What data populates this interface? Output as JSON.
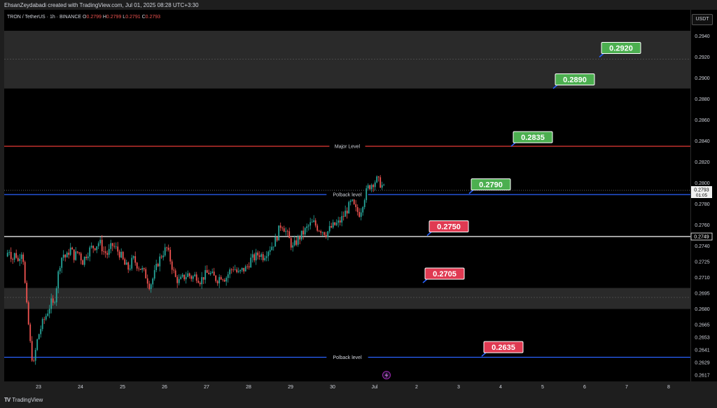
{
  "header": {
    "text": "EhsanZeydabadi created with TradingView.com, Jul 01, 2025 08:28 UTC+3:30"
  },
  "legend": {
    "symbol": "TRON / TetherUS · 1h · BINANCE",
    "o_label": "O",
    "o_value": "0.2799",
    "h_label": "H",
    "h_value": "0.2799",
    "l_label": "L",
    "l_value": "0.2791",
    "c_label": "C",
    "c_value": "0.2793"
  },
  "currency_label": "USDT",
  "brand": {
    "logo": "TV",
    "name": "TradingView"
  },
  "chart_data": {
    "type": "candlestick",
    "y_axis": {
      "min": 0.2611,
      "max": 0.2965,
      "tick_labels": [
        "0.2940",
        "0.2920",
        "0.2900",
        "0.2880",
        "0.2860",
        "0.2840",
        "0.2820",
        "0.2800",
        "0.2780",
        "0.2760",
        "0.2740",
        "0.2725",
        "0.2710",
        "0.2695",
        "0.2680",
        "0.2665",
        "0.2653",
        "0.2641",
        "0.2629",
        "0.2617"
      ]
    },
    "x_axis": {
      "tick_labels": [
        "23",
        "24",
        "25",
        "26",
        "27",
        "28",
        "29",
        "30",
        "Jul",
        "2",
        "3",
        "4",
        "5",
        "6",
        "7",
        "8"
      ],
      "tick_positions_days": [
        0,
        1,
        2,
        3,
        4,
        5,
        6,
        7,
        8,
        9,
        10,
        11,
        12,
        13,
        14,
        15
      ]
    },
    "current_price": {
      "value": 0.2793,
      "label": "0.2793",
      "countdown": "01:05",
      "color": "#f0f0f0"
    },
    "marked_price": {
      "value": 0.2749,
      "label": "0.2749"
    },
    "zones": [
      {
        "from": 0.289,
        "to": 0.2945,
        "color": "#2a2a2a",
        "midline": 0.2918
      },
      {
        "from": 0.268,
        "to": 0.27,
        "color": "#2a2a2a",
        "midline": 0.2691
      }
    ],
    "horizontal_lines": [
      {
        "value": 0.2835,
        "label": "Major Level",
        "color": "#e53935"
      },
      {
        "value": 0.2789,
        "label": "Polback level",
        "color": "#2962ff"
      },
      {
        "value": 0.2749,
        "label": "",
        "color": "#ffffff"
      },
      {
        "value": 0.2634,
        "label": "Polback level",
        "color": "#2962ff"
      }
    ],
    "targets": [
      {
        "value": "0.2920",
        "price": 0.292,
        "day": 13.4,
        "color": "#4caf50"
      },
      {
        "value": "0.2890",
        "price": 0.289,
        "day": 12.3,
        "color": "#4caf50"
      },
      {
        "value": "0.2835",
        "price": 0.2835,
        "day": 11.3,
        "color": "#4caf50"
      },
      {
        "value": "0.2790",
        "price": 0.279,
        "day": 10.3,
        "color": "#4caf50"
      },
      {
        "value": "0.2750",
        "price": 0.275,
        "day": 9.3,
        "color": "#e03a52"
      },
      {
        "value": "0.2705",
        "price": 0.2705,
        "day": 9.2,
        "color": "#e03a52"
      },
      {
        "value": "0.2635",
        "price": 0.2635,
        "day": 10.6,
        "color": "#e03a52"
      }
    ],
    "candles_path": [
      [
        -0.78,
        0.273
      ],
      [
        -0.7,
        0.2737
      ],
      [
        -0.62,
        0.2727
      ],
      [
        -0.55,
        0.2734
      ],
      [
        -0.48,
        0.2724
      ],
      [
        -0.42,
        0.2738
      ],
      [
        -0.36,
        0.2727
      ],
      [
        -0.3,
        0.269
      ],
      [
        -0.25,
        0.267
      ],
      [
        -0.2,
        0.2648
      ],
      [
        -0.16,
        0.2636
      ],
      [
        -0.12,
        0.2625
      ],
      [
        -0.08,
        0.2638
      ],
      [
        -0.04,
        0.2648
      ],
      [
        0.0,
        0.2655
      ],
      [
        0.08,
        0.2665
      ],
      [
        0.16,
        0.2672
      ],
      [
        0.24,
        0.268
      ],
      [
        0.3,
        0.2686
      ],
      [
        0.36,
        0.2683
      ],
      [
        0.42,
        0.27
      ],
      [
        0.5,
        0.2722
      ],
      [
        0.58,
        0.2733
      ],
      [
        0.66,
        0.2728
      ],
      [
        0.75,
        0.2738
      ],
      [
        0.85,
        0.273
      ],
      [
        0.95,
        0.2735
      ],
      [
        1.05,
        0.2725
      ],
      [
        1.15,
        0.2733
      ],
      [
        1.25,
        0.2738
      ],
      [
        1.35,
        0.274
      ],
      [
        1.45,
        0.2744
      ],
      [
        1.55,
        0.2735
      ],
      [
        1.65,
        0.2732
      ],
      [
        1.75,
        0.2741
      ],
      [
        1.85,
        0.2737
      ],
      [
        1.95,
        0.2732
      ],
      [
        2.05,
        0.2722
      ],
      [
        2.15,
        0.2718
      ],
      [
        2.25,
        0.2728
      ],
      [
        2.35,
        0.2722
      ],
      [
        2.45,
        0.2718
      ],
      [
        2.55,
        0.2712
      ],
      [
        2.65,
        0.2702
      ],
      [
        2.75,
        0.2712
      ],
      [
        2.85,
        0.2725
      ],
      [
        2.95,
        0.2733
      ],
      [
        3.05,
        0.2738
      ],
      [
        3.15,
        0.2725
      ],
      [
        3.25,
        0.271
      ],
      [
        3.35,
        0.2706
      ],
      [
        3.45,
        0.271
      ],
      [
        3.55,
        0.2713
      ],
      [
        3.65,
        0.271
      ],
      [
        3.75,
        0.2712
      ],
      [
        3.85,
        0.2707
      ],
      [
        3.95,
        0.2712
      ],
      [
        4.05,
        0.2715
      ],
      [
        4.15,
        0.2711
      ],
      [
        4.25,
        0.2708
      ],
      [
        4.35,
        0.2712
      ],
      [
        4.45,
        0.2709
      ],
      [
        4.55,
        0.2716
      ],
      [
        4.65,
        0.272
      ],
      [
        4.75,
        0.2713
      ],
      [
        4.85,
        0.2717
      ],
      [
        4.95,
        0.2719
      ],
      [
        5.05,
        0.2727
      ],
      [
        5.15,
        0.2729
      ],
      [
        5.25,
        0.2733
      ],
      [
        5.35,
        0.273
      ],
      [
        5.45,
        0.2736
      ],
      [
        5.55,
        0.274
      ],
      [
        5.65,
        0.2746
      ],
      [
        5.72,
        0.2755
      ],
      [
        5.78,
        0.2762
      ],
      [
        5.86,
        0.2756
      ],
      [
        5.95,
        0.2748
      ],
      [
        6.05,
        0.2738
      ],
      [
        6.15,
        0.2745
      ],
      [
        6.25,
        0.275
      ],
      [
        6.35,
        0.2755
      ],
      [
        6.45,
        0.276
      ],
      [
        6.55,
        0.2762
      ],
      [
        6.65,
        0.2757
      ],
      [
        6.75,
        0.2755
      ],
      [
        6.85,
        0.2752
      ],
      [
        6.95,
        0.2757
      ],
      [
        7.05,
        0.276
      ],
      [
        7.15,
        0.2762
      ],
      [
        7.25,
        0.2768
      ],
      [
        7.35,
        0.2775
      ],
      [
        7.45,
        0.2782
      ],
      [
        7.55,
        0.2774
      ],
      [
        7.65,
        0.2771
      ],
      [
        7.75,
        0.2786
      ],
      [
        7.85,
        0.2796
      ],
      [
        7.95,
        0.28
      ],
      [
        8.05,
        0.2803
      ],
      [
        8.15,
        0.2799
      ],
      [
        8.25,
        0.2793
      ]
    ]
  }
}
